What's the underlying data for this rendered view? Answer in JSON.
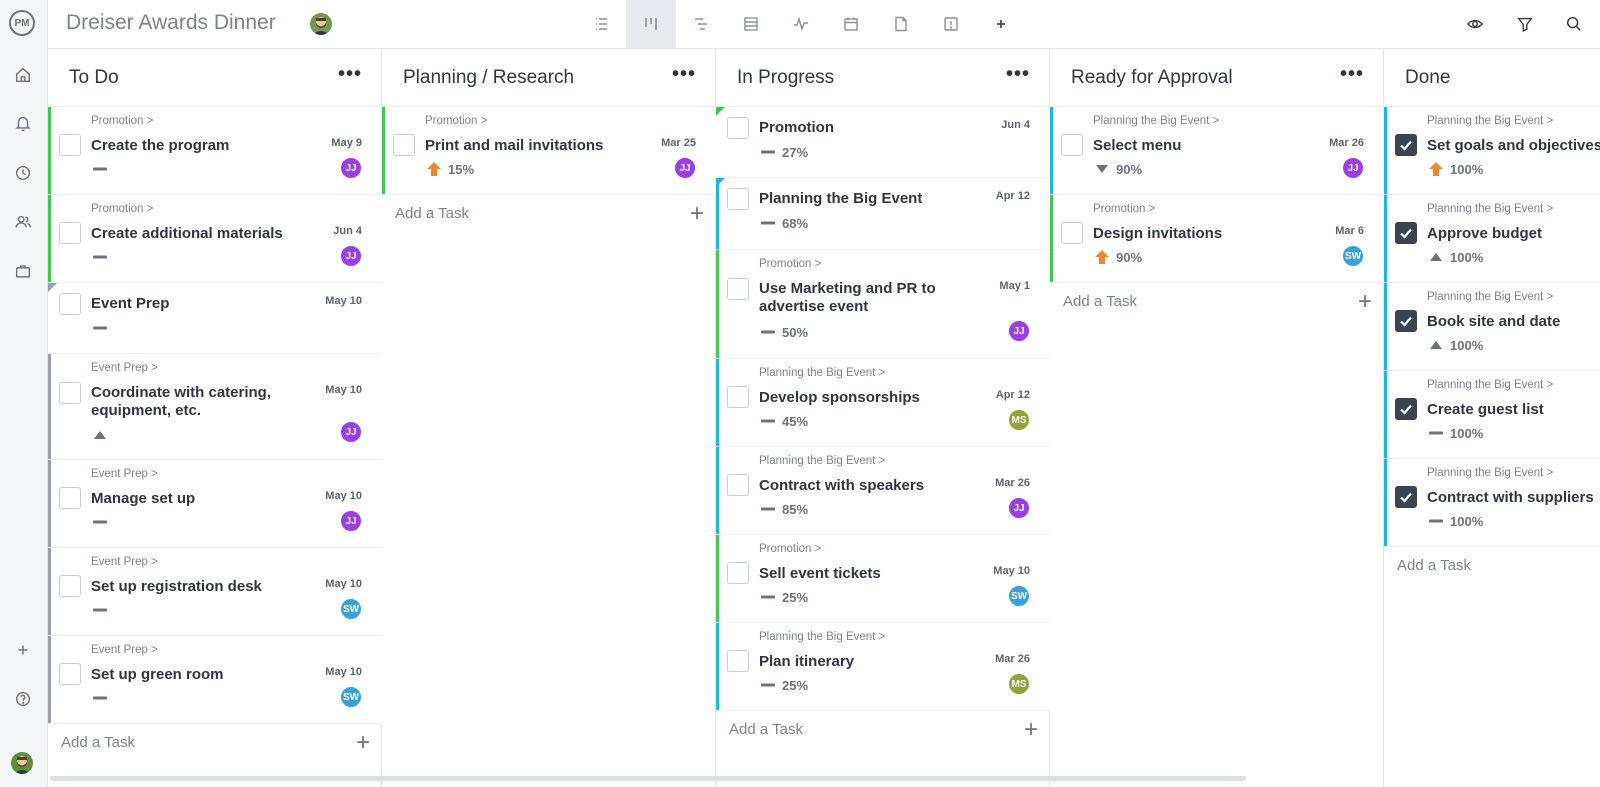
{
  "app": {
    "logo": "PM",
    "project_title": "Dreiser Awards Dinner"
  },
  "rail": {
    "icons": [
      "home-icon",
      "bell-icon",
      "clock-icon",
      "people-icon",
      "briefcase-icon",
      "plus-icon",
      "help-icon"
    ]
  },
  "toolbar": {
    "views": [
      "list-view-icon",
      "board-view-icon",
      "gantt-view-icon",
      "sheet-view-icon",
      "dashboard-view-icon",
      "calendar-view-icon",
      "docs-view-icon",
      "overview-icon",
      "add-view-icon"
    ],
    "active_view": "board-view-icon",
    "right_icons": [
      "eye-icon",
      "filter-icon",
      "search-icon"
    ]
  },
  "colors": {
    "green": "#41c754",
    "cyan": "#1cb8e0",
    "gray": "#9aa1ad",
    "purple": "#9b3ee3",
    "blue": "#3aa2d8",
    "olive": "#93a33a",
    "orange": "#e8892b"
  },
  "add_task_label": "Add a Task",
  "columns": [
    {
      "title": "To Do",
      "cards": [
        {
          "crumb": "Promotion >",
          "name": "Create the program",
          "date": "May 9",
          "priority": "medium",
          "assignee": "JJ"
        },
        {
          "crumb": "Promotion >",
          "name": "Create additional materials",
          "date": "Jun 4",
          "priority": "medium",
          "assignee": "JJ"
        },
        {
          "crumb": "",
          "name": "Event Prep",
          "date": "May 10",
          "priority": "medium",
          "assignee": ""
        },
        {
          "crumb": "Event Prep >",
          "name": "Coordinate with catering, equipment, etc.",
          "date": "May 10",
          "priority": "high",
          "assignee": "JJ"
        },
        {
          "crumb": "Event Prep >",
          "name": "Manage set up",
          "date": "May 10",
          "priority": "medium",
          "assignee": "JJ"
        },
        {
          "crumb": "Event Prep >",
          "name": "Set up registration desk",
          "date": "May 10",
          "priority": "medium",
          "assignee": "SW"
        },
        {
          "crumb": "Event Prep >",
          "name": "Set up green room",
          "date": "May 10",
          "priority": "medium",
          "assignee": "SW"
        }
      ]
    },
    {
      "title": "Planning / Research",
      "cards": [
        {
          "crumb": "Promotion >",
          "name": "Print and mail invitations",
          "date": "Mar 25",
          "priority": "critical",
          "progress": "15%",
          "assignee": "JJ"
        }
      ]
    },
    {
      "title": "In Progress",
      "cards": [
        {
          "crumb": "",
          "name": "Promotion",
          "date": "Jun 4",
          "priority": "medium",
          "progress": "27%",
          "assignee": ""
        },
        {
          "crumb": "",
          "name": "Planning the Big Event",
          "date": "Apr 12",
          "priority": "medium",
          "progress": "68%",
          "assignee": ""
        },
        {
          "crumb": "Promotion >",
          "name": "Use Marketing and PR to advertise event",
          "date": "May 1",
          "priority": "medium",
          "progress": "50%",
          "assignee": "JJ"
        },
        {
          "crumb": "Planning the Big Event >",
          "name": "Develop sponsorships",
          "date": "Apr 12",
          "priority": "medium",
          "progress": "45%",
          "assignee": "MS"
        },
        {
          "crumb": "Planning the Big Event >",
          "name": "Contract with speakers",
          "date": "Mar 26",
          "priority": "medium",
          "progress": "85%",
          "assignee": "JJ"
        },
        {
          "crumb": "Promotion >",
          "name": "Sell event tickets",
          "date": "May 10",
          "priority": "medium",
          "progress": "25%",
          "assignee": "SW"
        },
        {
          "crumb": "Planning the Big Event >",
          "name": "Plan itinerary",
          "date": "Mar 26",
          "priority": "medium",
          "progress": "25%",
          "assignee": "MS"
        }
      ]
    },
    {
      "title": "Ready for Approval",
      "cards": [
        {
          "crumb": "Planning the Big Event >",
          "name": "Select menu",
          "date": "Mar 26",
          "priority": "low",
          "progress": "90%",
          "assignee": "JJ"
        },
        {
          "crumb": "Promotion >",
          "name": "Design invitations",
          "date": "Mar 6",
          "priority": "critical",
          "progress": "90%",
          "assignee": "SW"
        }
      ]
    },
    {
      "title": "Done",
      "cards": [
        {
          "crumb": "Planning the Big Event >",
          "name": "Set goals and objectives",
          "date": "",
          "priority": "critical",
          "progress": "100%",
          "assignee": ""
        },
        {
          "crumb": "Planning the Big Event >",
          "name": "Approve budget",
          "date": "",
          "priority": "high",
          "progress": "100%",
          "assignee": ""
        },
        {
          "crumb": "Planning the Big Event >",
          "name": "Book site and date",
          "date": "",
          "priority": "high",
          "progress": "100%",
          "assignee": ""
        },
        {
          "crumb": "Planning the Big Event >",
          "name": "Create guest list",
          "date": "",
          "priority": "medium",
          "progress": "100%",
          "assignee": ""
        },
        {
          "crumb": "Planning the Big Event >",
          "name": "Contract with suppliers",
          "date": "",
          "priority": "medium",
          "progress": "100%",
          "assignee": ""
        }
      ]
    }
  ]
}
